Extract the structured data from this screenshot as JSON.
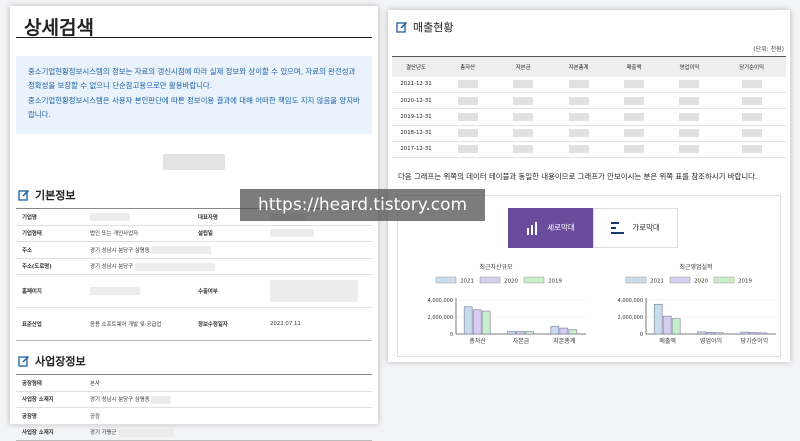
{
  "left": {
    "title": "상세검색",
    "notice": [
      "중소기업현황정보시스템의 정보는 자료의 갱신시점에 따라 실제 정보와 상이할 수 있으며, 자료의 완전성과 정확성을 보장할 수 없으니 단순참고용으로만 활용바랍니다.",
      "중소기업현황정보시스템은 사용자 본인판단에 따른 정보이용 결과에 대해 어떠한 책임도 지지 않음을 양지바랍니다."
    ],
    "basic": {
      "title": "기본정보",
      "rows": [
        {
          "l1": "기업명",
          "v1": "",
          "l2": "대표자명",
          "v2": ""
        },
        {
          "l1": "기업형태",
          "v1": "법인 또는 개인사업자",
          "l2": "설립일",
          "v2": ""
        },
        {
          "l1": "주소",
          "v1": "경기 성남시 분당구 삼평동",
          "l2": "",
          "v2": ""
        },
        {
          "l1": "주소(도로명)",
          "v1": "경기 성남시 분당구",
          "l2": "",
          "v2": ""
        },
        {
          "l1": "홈페이지",
          "v1": "",
          "l2": "수출여부",
          "v2": ""
        },
        {
          "l1": "표준산업",
          "v1": "응용 소프트웨어 개발 및 공급업",
          "l2": "정보수정일자",
          "v2": "2022.07.11"
        }
      ]
    },
    "site": {
      "title": "사업장정보",
      "rows": [
        {
          "l": "공장형태",
          "v": "본사"
        },
        {
          "l": "사업장 소재지",
          "v": "경기 성남시 분당구 삼평동"
        },
        {
          "l": "공장명",
          "v": "공장"
        },
        {
          "l": "사업장 소재지",
          "v": "경기 가평군"
        }
      ]
    }
  },
  "right": {
    "title": "매출현황",
    "unit": "(단위: 천원)",
    "headers": [
      "결산년도",
      "총자산",
      "자본금",
      "자본총계",
      "매출액",
      "영업이익",
      "당기순이익"
    ],
    "years": [
      "2021-12-31",
      "2020-12-31",
      "2019-12-31",
      "2018-12-31",
      "2017-12-31"
    ],
    "graph_note": "다음 그래프는 위쪽의 데이터 테이블과 동일한 내용이므로 그래프가 안보이시는 분은 위쪽 표를 참조하시기 바랍니다.",
    "tabs": {
      "vertical": "세로막대",
      "horizontal": "가로막대"
    }
  },
  "watermark": "https://heard.tistory.com",
  "chart_data": [
    {
      "type": "bar",
      "title": "최근자산규모",
      "categories": [
        "총자산",
        "자본금",
        "자본총계"
      ],
      "series": [
        {
          "name": "2021",
          "values": [
            3200000,
            300000,
            900000
          ],
          "color": "#c7dcec"
        },
        {
          "name": "2020",
          "values": [
            2850000,
            300000,
            700000
          ],
          "color": "#d7cdf0"
        },
        {
          "name": "2019",
          "values": [
            2700000,
            300000,
            500000
          ],
          "color": "#c9efc9"
        }
      ],
      "yticks": [
        "4,000,000",
        "2,000,000",
        "0"
      ],
      "ylim": [
        0,
        4000000
      ]
    },
    {
      "type": "bar",
      "title": "최근영업실적",
      "categories": [
        "매출액",
        "영업이익",
        "당기순이익"
      ],
      "series": [
        {
          "name": "2021",
          "values": [
            3500000,
            250000,
            220000
          ],
          "color": "#c7dcec"
        },
        {
          "name": "2020",
          "values": [
            2100000,
            200000,
            180000
          ],
          "color": "#d7cdf0"
        },
        {
          "name": "2019",
          "values": [
            1800000,
            150000,
            130000
          ],
          "color": "#c9efc9"
        }
      ],
      "yticks": [
        "4,000,000",
        "2,000,000",
        "0"
      ],
      "ylim": [
        0,
        4000000
      ]
    }
  ]
}
